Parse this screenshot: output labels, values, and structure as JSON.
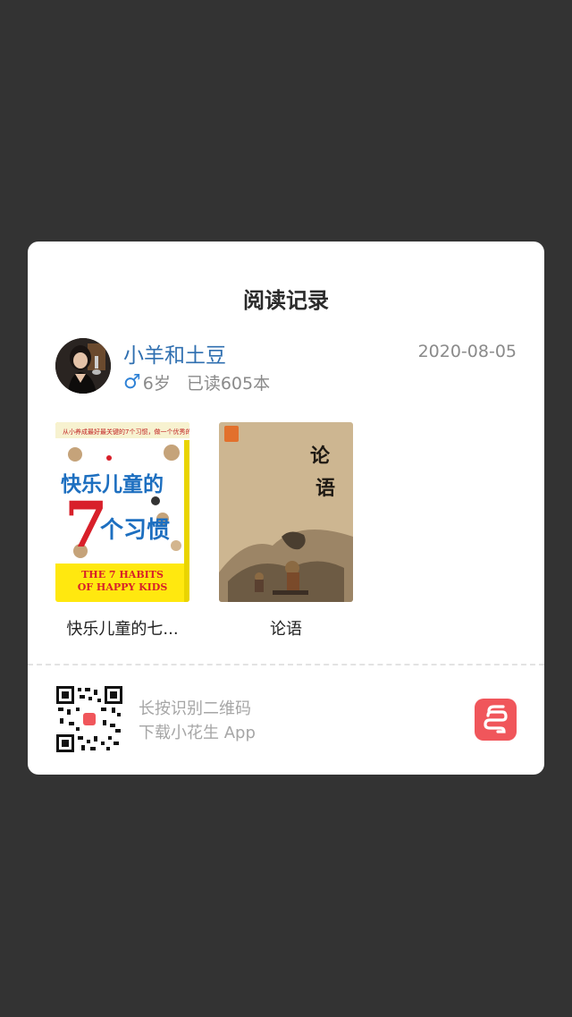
{
  "card": {
    "title": "阅读记录"
  },
  "user": {
    "name": "小羊和土豆",
    "gender_icon": "♂",
    "age": "6岁",
    "read_count": "已读605本",
    "date": "2020-08-05"
  },
  "books": [
    {
      "title": "快乐儿童的七...",
      "cover": {
        "top_text": "从小养成最好最关键的7个习惯，做一个优秀的人",
        "title_cn_1": "快乐儿童的",
        "numeral": "7",
        "title_cn_2": "个习惯",
        "title_en_1": "THE 7 HABITS",
        "title_en_2": "OF HAPPY KIDS"
      }
    },
    {
      "title": "论语",
      "cover": {
        "char_1": "论",
        "char_2": "语"
      }
    }
  ],
  "footer": {
    "scan_line_1": "长按识别二维码",
    "scan_line_2": "下载小花生 App",
    "qr_icon": "qr-code-icon",
    "app_icon": "xiaohuasheng-app-icon"
  },
  "colors": {
    "overlay": "#333333",
    "username": "#2f6fb0",
    "male": "#2f82d6",
    "app_brand": "#f0565b"
  }
}
